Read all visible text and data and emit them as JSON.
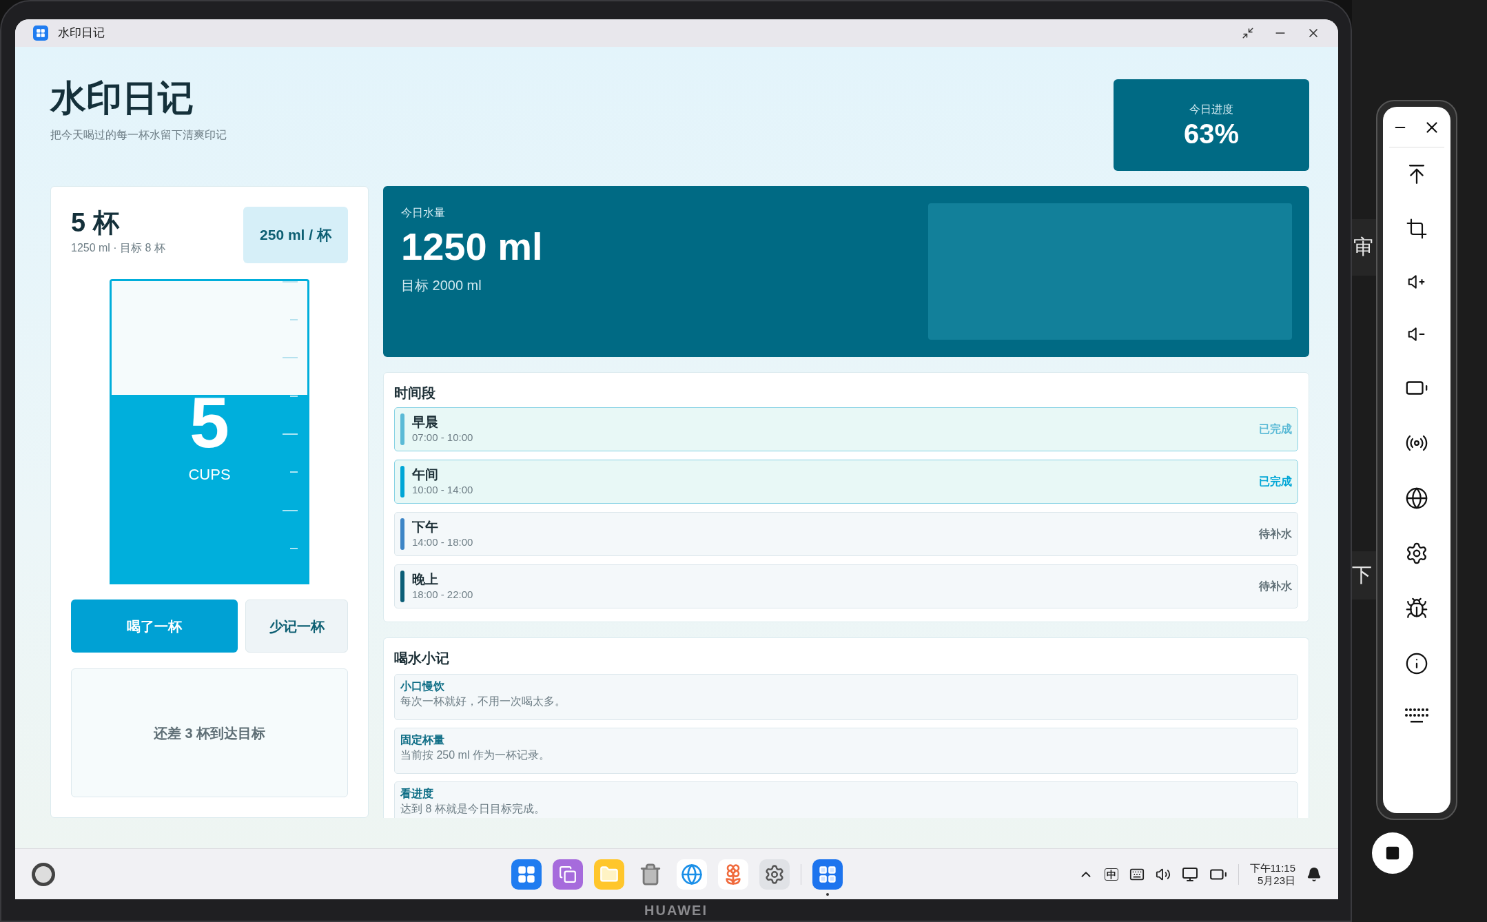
{
  "device": {
    "brand": "HUAWEI"
  },
  "window": {
    "title": "水印日记"
  },
  "header": {
    "title": "水印日记",
    "subtitle": "把今天喝过的每一杯水留下清爽印记"
  },
  "progress": {
    "label": "今日进度",
    "value": "63%"
  },
  "cups": {
    "count": "5 杯",
    "detail": "1250 ml · 目标 8 杯",
    "per_cup": "250 ml / 杯",
    "level": 0.625,
    "number": "5",
    "unit": "CUPS",
    "buttons": [
      {
        "label": "喝了一杯",
        "kind": "primary"
      },
      {
        "label": "少记一杯",
        "kind": "secondary"
      }
    ],
    "message": "还差 3 杯到达目标"
  },
  "today": {
    "label": "今日水量",
    "amount": "1250 ml",
    "goal": "目标 2000 ml"
  },
  "periods": {
    "title": "时间段",
    "items": [
      {
        "name": "早晨",
        "time": "07:00 - 10:00",
        "status": "已完成",
        "done": true,
        "color": "#5bbad6"
      },
      {
        "name": "午间",
        "time": "10:00 - 14:00",
        "status": "已完成",
        "done": true,
        "color": "#00a6d6"
      },
      {
        "name": "下午",
        "time": "14:00 - 18:00",
        "status": "待补水",
        "done": false,
        "color": "#3d85c6"
      },
      {
        "name": "晚上",
        "time": "18:00 - 22:00",
        "status": "待补水",
        "done": false,
        "color": "#0b5e77"
      }
    ]
  },
  "notes": {
    "title": "喝水小记",
    "items": [
      {
        "title": "小口慢饮",
        "text": "每次一杯就好，不用一次喝太多。"
      },
      {
        "title": "固定杯量",
        "text": "当前按 250 ml 作为一杯记录。"
      },
      {
        "title": "看进度",
        "text": "达到 8 杯就是今日目标完成。"
      }
    ]
  },
  "taskbar": {
    "apps": [
      {
        "kind": "grid",
        "running": false
      },
      {
        "kind": "windows",
        "running": false
      },
      {
        "kind": "folder",
        "running": false
      },
      {
        "kind": "trash",
        "running": false
      },
      {
        "kind": "browser",
        "running": false
      },
      {
        "kind": "photos",
        "running": false
      },
      {
        "kind": "settings",
        "running": false
      },
      {
        "kind": "app",
        "running": true
      }
    ],
    "input_method": "中",
    "time": "下午11:15",
    "date": "5月23日"
  },
  "background_text": [
    "审",
    "下"
  ]
}
